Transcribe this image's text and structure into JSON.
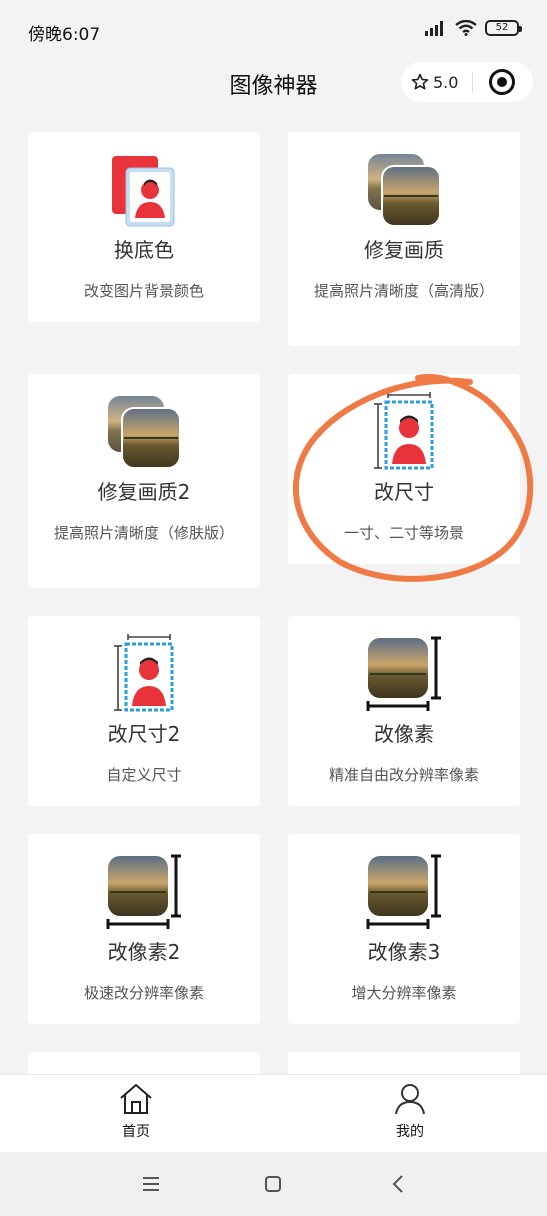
{
  "status": {
    "time": "傍晚6:07",
    "battery": "52"
  },
  "header": {
    "title": "图像神器",
    "rating": "5.0"
  },
  "cards": [
    {
      "name": "换底色",
      "desc": "改变图片背景颜色"
    },
    {
      "name": "修复画质",
      "desc": "提高照片清晰度（高清版）"
    },
    {
      "name": "修复画质2",
      "desc": "提高照片清晰度（修肤版）"
    },
    {
      "name": "改尺寸",
      "desc": "一寸、二寸等场景"
    },
    {
      "name": "改尺寸2",
      "desc": "自定义尺寸"
    },
    {
      "name": "改像素",
      "desc": "精准自由改分辨率像素"
    },
    {
      "name": "改像素2",
      "desc": "极速改分辨率像素"
    },
    {
      "name": "改像素3",
      "desc": "增大分辨率像素"
    }
  ],
  "tabbar": {
    "home": "首页",
    "mine": "我的"
  },
  "colors": {
    "accent_red": "#e8333a",
    "accent_blue": "#2a9fd6",
    "highlight": "#ef7a45"
  }
}
